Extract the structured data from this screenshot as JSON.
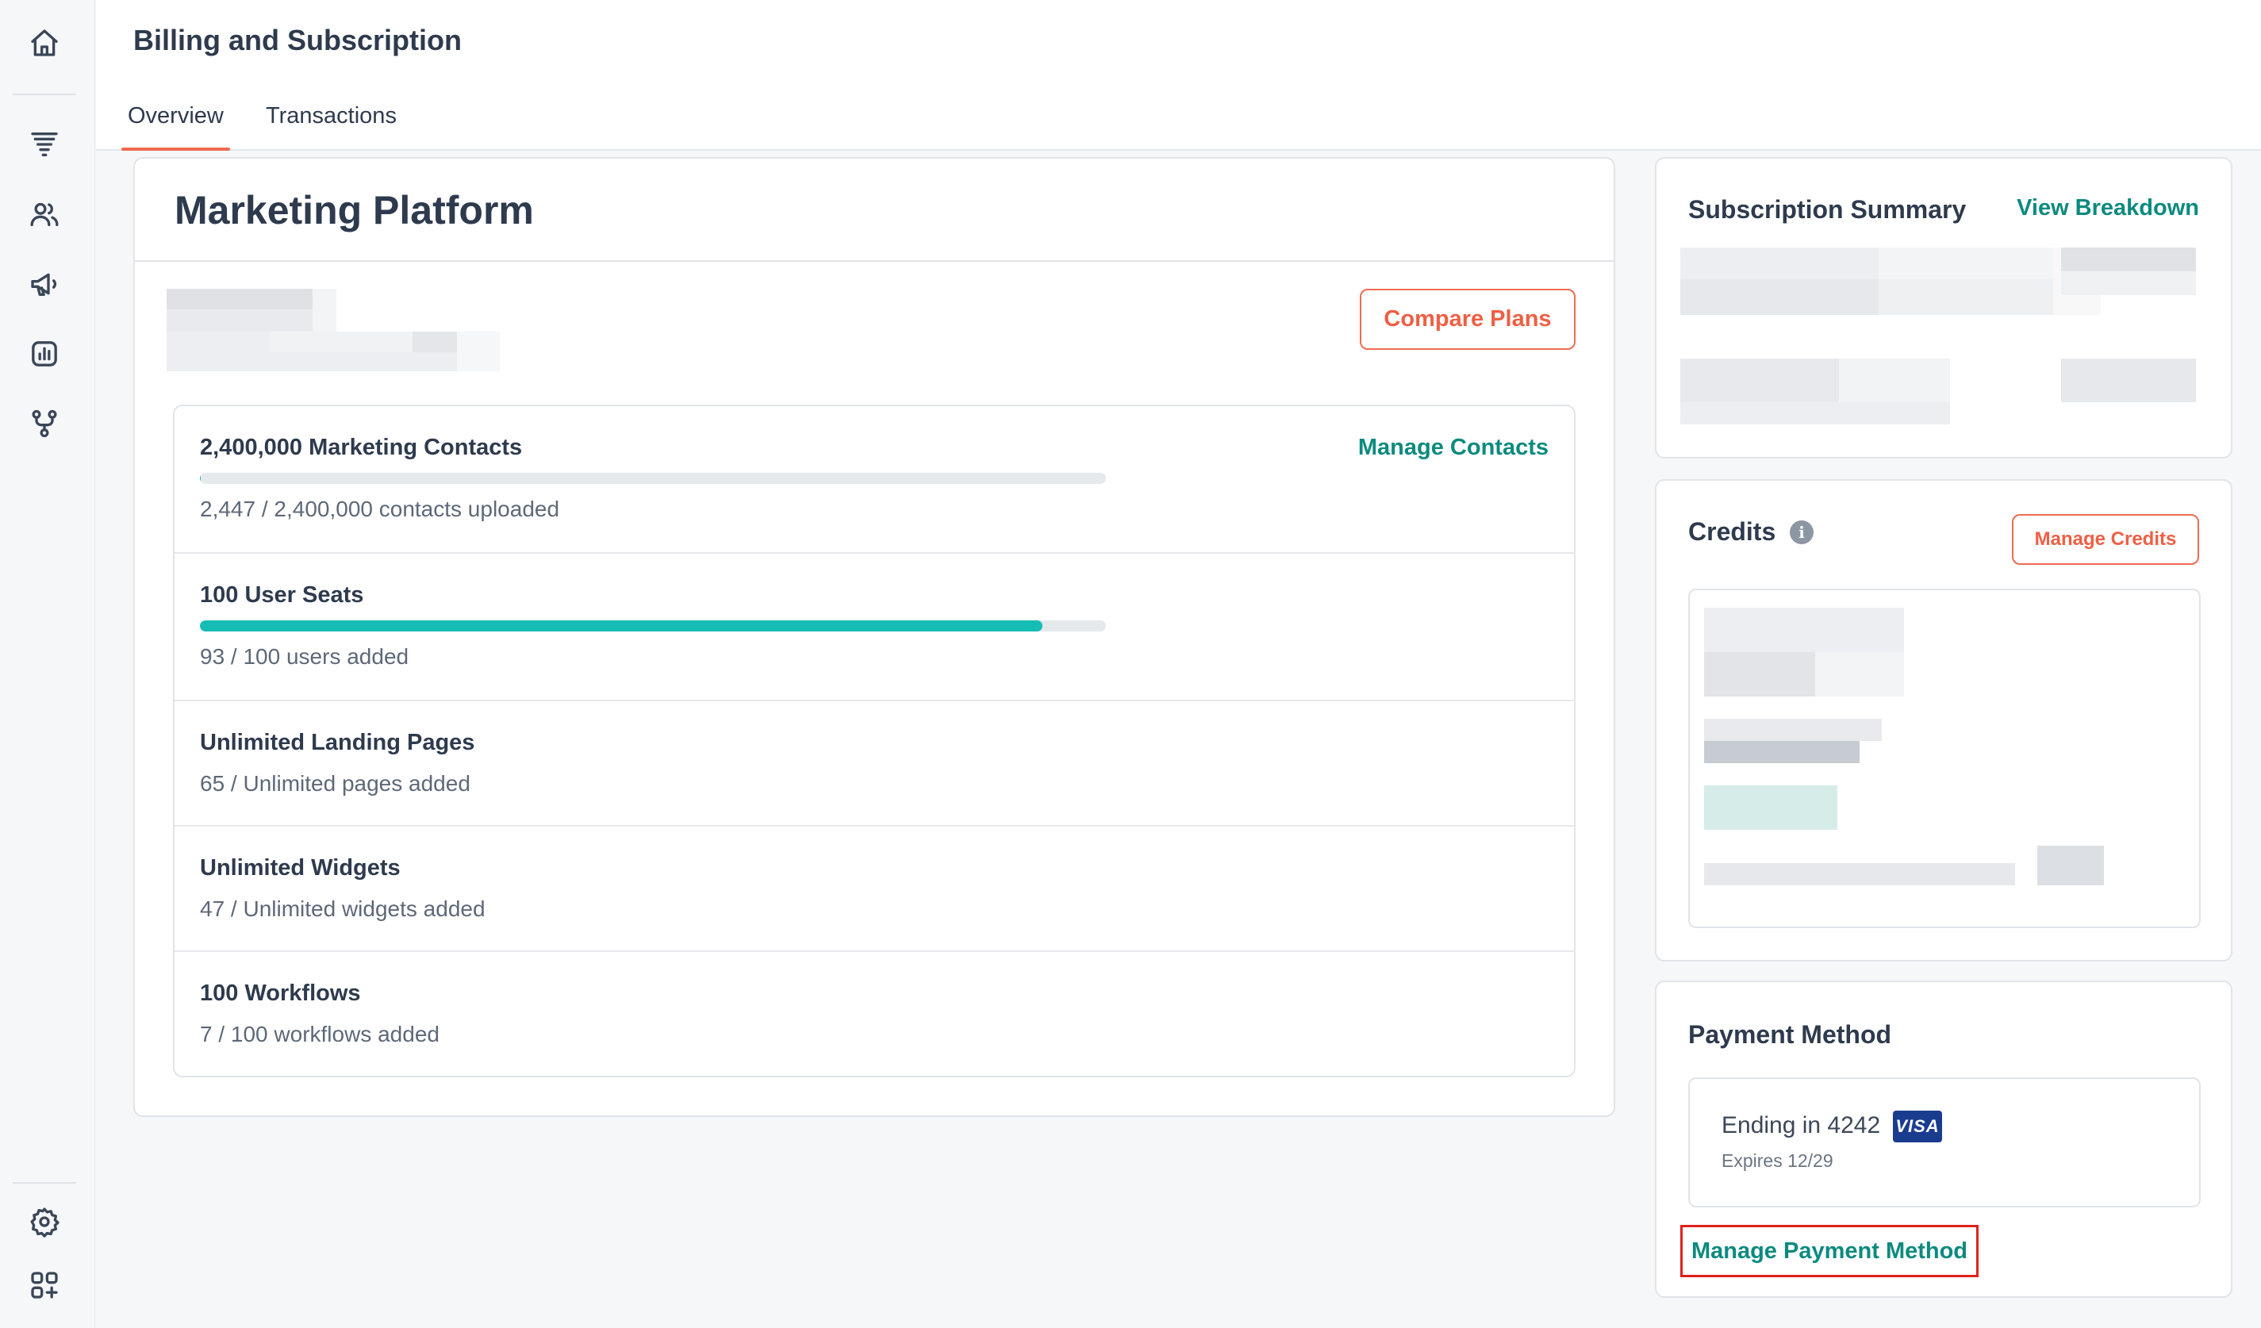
{
  "header": {
    "title": "Billing and Subscription",
    "tabs": [
      {
        "label": "Overview",
        "active": true
      },
      {
        "label": "Transactions",
        "active": false
      }
    ]
  },
  "sidebar": {
    "icons": [
      "home-icon",
      "funnel-icon",
      "contacts-icon",
      "megaphone-icon",
      "reports-icon",
      "workflow-icon",
      "settings-icon",
      "apps-icon"
    ]
  },
  "plan": {
    "title": "Marketing Platform",
    "compare_label": "Compare Plans",
    "usage": [
      {
        "title": "2,400,000 Marketing Contacts",
        "sub": "2,447 / 2,400,000 contacts uploaded",
        "action": "Manage Contacts",
        "progress": 0.001
      },
      {
        "title": "100 User Seats",
        "sub": "93 / 100 users added",
        "progress": 0.93
      },
      {
        "title": "Unlimited Landing Pages",
        "sub": "65 / Unlimited pages added"
      },
      {
        "title": "Unlimited Widgets",
        "sub": "47 / Unlimited widgets added"
      },
      {
        "title": "100 Workflows",
        "sub": "7 / 100 workflows added"
      }
    ]
  },
  "summary": {
    "title": "Subscription Summary",
    "action": "View Breakdown"
  },
  "credits": {
    "title": "Credits",
    "info_glyph": "i",
    "action": "Manage Credits"
  },
  "payment": {
    "title": "Payment Method",
    "ending": "Ending in 4242",
    "brand": "VISA",
    "expires": "Expires 12/29",
    "action": "Manage Payment Method"
  },
  "colors": {
    "accent_orange": "#ef6b52",
    "link_teal": "#0c8a7f",
    "progress_teal": "#16bdb4",
    "highlight_red": "#e0211a",
    "visa_blue": "#1a3c8f"
  }
}
